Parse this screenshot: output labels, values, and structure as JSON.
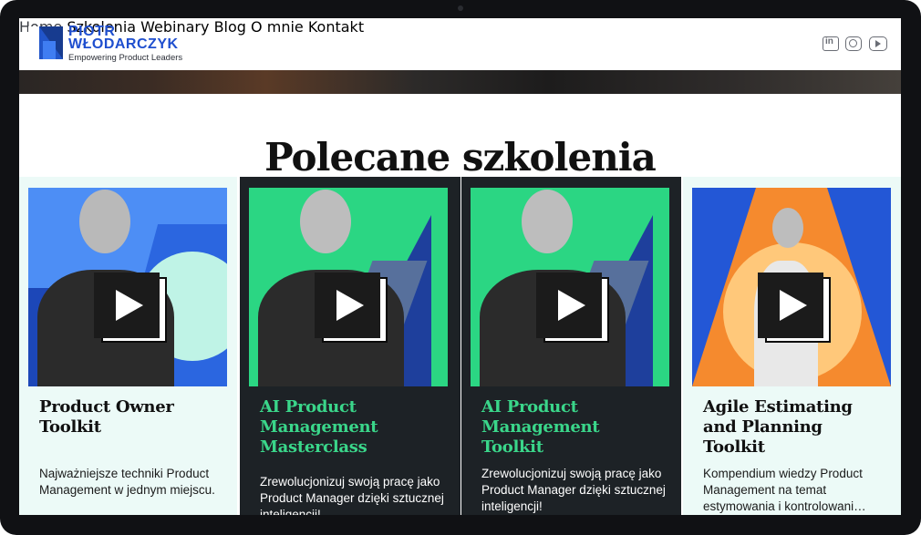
{
  "brand": {
    "name": "PIOTR\nWŁODARCZYK",
    "tagline": "Empowering Product Leaders"
  },
  "nav": {
    "items": [
      "Home",
      "Szkolenia",
      "Webinary",
      "Blog",
      "O mnie",
      "Kontakt"
    ],
    "active": "Home"
  },
  "social": [
    "linkedin-icon",
    "instagram-icon",
    "youtube-icon"
  ],
  "page": {
    "title": "Polecane szkolenia"
  },
  "courses": [
    {
      "title": "Product Owner Toolkit",
      "description": "Najważniejsze techniki Product Management w jednym miejscu.",
      "theme": "light",
      "thumb_color": "#3f7df2"
    },
    {
      "title": "AI Product Management Masterclass",
      "description": "Zrewolucjonizuj swoją pracę jako Product Manager dzięki sztucznej inteligencji!",
      "theme": "dark",
      "thumb_color": "#2bd683"
    },
    {
      "title": "AI Product Management Toolkit",
      "description": "Zrewolucjonizuj swoją pracę jako Product Manager dzięki sztucznej inteligencji!",
      "theme": "dark",
      "thumb_color": "#2bd683"
    },
    {
      "title": "Agile Estimating and Planning Toolkit",
      "description": "Kompendium wiedzy Product Management na temat estymowania i kontrolowani…",
      "theme": "light",
      "thumb_color": "#f58a2e"
    }
  ],
  "colors": {
    "brand_blue": "#1f4fcf",
    "accent_green": "#3ad68a",
    "dark_card": "#1d2226",
    "light_card": "#ecfaf7"
  }
}
